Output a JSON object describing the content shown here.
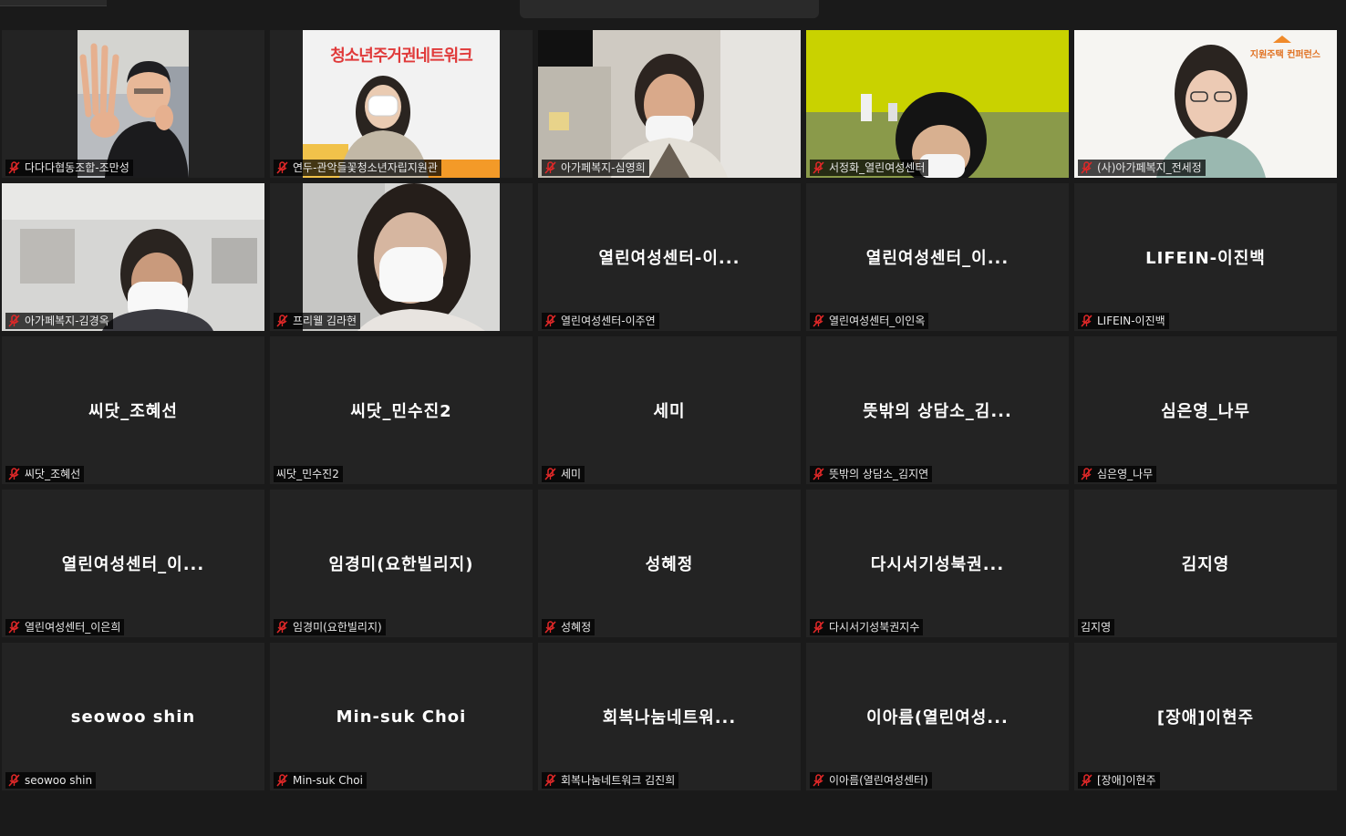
{
  "window": {
    "title": "",
    "muted_color": "#e02828"
  },
  "tiles": [
    {
      "center": "",
      "label": "다다다협동조합-조만성",
      "muted": true
    },
    {
      "center": "",
      "label": "연두-관악들꽃청소년자립지원관",
      "muted": true,
      "banner": "청소년주거권네트워크"
    },
    {
      "center": "",
      "label": "아가페복지-심영희",
      "muted": true
    },
    {
      "center": "",
      "label": "서정화_열린여성센터",
      "muted": true
    },
    {
      "center": "",
      "label": "(사)아가페복지_전세정",
      "muted": true,
      "logo_text": "지원주택 컨퍼런스"
    },
    {
      "center": "",
      "label": "아가페복지-김경옥",
      "muted": true
    },
    {
      "center": "",
      "label": "프리웰 김라현",
      "muted": true
    },
    {
      "center": "열린여성센터-이...",
      "label": "열린여성센터-이주연",
      "muted": true
    },
    {
      "center": "열린여성센터_이...",
      "label": "열린여성센터_이인옥",
      "muted": true
    },
    {
      "center": "LIFEIN-이진백",
      "label": "LIFEIN-이진백",
      "muted": true
    },
    {
      "center": "씨닷_조혜선",
      "label": "씨닷_조혜선",
      "muted": true
    },
    {
      "center": "씨닷_민수진2",
      "label": "씨닷_민수진2",
      "muted": false
    },
    {
      "center": "세미",
      "label": "세미",
      "muted": true
    },
    {
      "center": "뜻밖의 상담소_김...",
      "label": "뜻밖의 상담소_김지연",
      "muted": true
    },
    {
      "center": "심은영_나무",
      "label": "심은영_나무",
      "muted": true
    },
    {
      "center": "열린여성센터_이...",
      "label": "열린여성센터_이은희",
      "muted": true
    },
    {
      "center": "임경미(요한빌리지)",
      "label": "임경미(요한빌리지)",
      "muted": true
    },
    {
      "center": "성혜정",
      "label": "성혜정",
      "muted": true
    },
    {
      "center": "다시서기성북권...",
      "label": "다시서기성북권지수",
      "muted": true
    },
    {
      "center": "김지영",
      "label": "김지영",
      "muted": false
    },
    {
      "center": "seowoo shin",
      "label": "seowoo shin",
      "muted": true
    },
    {
      "center": "Min-suk Choi",
      "label": "Min-suk Choi",
      "muted": true
    },
    {
      "center": "회복나눔네트워...",
      "label": "회복나눔네트워크 김진희",
      "muted": true
    },
    {
      "center": "이아름(열린여성...",
      "label": "이아름(열린여성센터)",
      "muted": true
    },
    {
      "center": "[장애]이현주",
      "label": "[장애]이현주",
      "muted": true
    }
  ]
}
